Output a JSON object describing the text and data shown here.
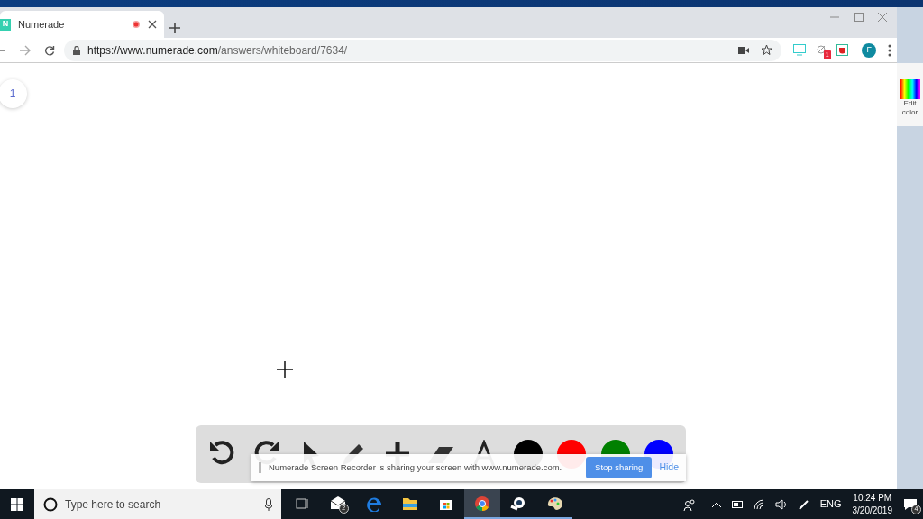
{
  "browser": {
    "tab": {
      "title": "Numerade",
      "favicon": "N",
      "recording": true
    },
    "url": {
      "host": "https://www.numerade.com",
      "path": "/answers/whiteboard/7634/"
    },
    "extension_badge": "1",
    "profile_initial": "F"
  },
  "page": {
    "page_number": "1"
  },
  "toolbar": {
    "tools": [
      {
        "kind": "undo"
      },
      {
        "kind": "redo"
      },
      {
        "kind": "pointer"
      },
      {
        "kind": "pencil"
      },
      {
        "kind": "plus"
      },
      {
        "kind": "eraser"
      },
      {
        "kind": "text"
      }
    ],
    "colors": [
      {
        "color": "#000000"
      },
      {
        "color": "#ff0000"
      },
      {
        "color": "#008000"
      },
      {
        "color": "#0000ff"
      }
    ]
  },
  "share_notice": {
    "message": "Numerade Screen Recorder is sharing your screen with www.numerade.com.",
    "stop_button": "Stop sharing",
    "hide_link": "Hide"
  },
  "background_app": {
    "label": "Edit color"
  },
  "taskbar": {
    "search_placeholder": "Type here to search",
    "apps": [
      {
        "kind": "taskview",
        "active": false,
        "running": false
      },
      {
        "kind": "mail",
        "badge": "2",
        "active": false,
        "running": false
      },
      {
        "kind": "edge",
        "active": false,
        "running": false
      },
      {
        "kind": "files",
        "active": false,
        "running": false
      },
      {
        "kind": "store",
        "active": false,
        "running": false
      },
      {
        "kind": "chrome",
        "active": true,
        "running": true
      },
      {
        "kind": "steam",
        "active": false,
        "running": true
      },
      {
        "kind": "paint",
        "active": false,
        "running": true
      }
    ],
    "language": "ENG",
    "time": "10:24 PM",
    "date": "3/20/2019",
    "notification_count": "4"
  }
}
